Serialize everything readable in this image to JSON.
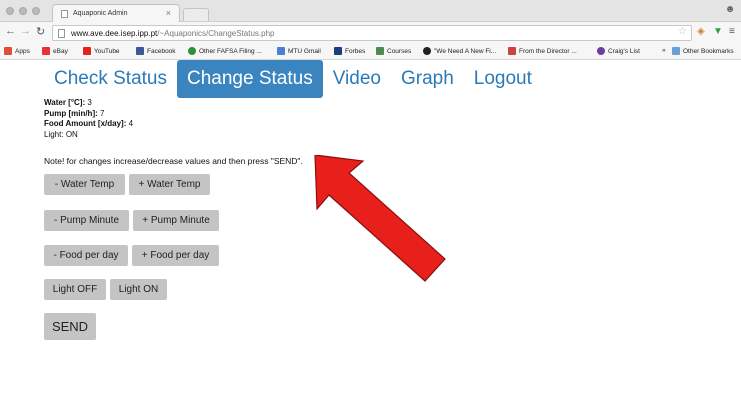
{
  "browser": {
    "tab_title": "Aquaponic Admin",
    "tab_close": "×",
    "url_host": "www.ave.dee.isep.ipp.pt",
    "url_path": "/~Aquaponics/ChangeStatus.php"
  },
  "bookmarks": [
    {
      "label": "Apps",
      "color": "#e04e39"
    },
    {
      "label": "eBay",
      "color": "#e53238"
    },
    {
      "label": "YouTube",
      "color": "#e62117"
    },
    {
      "label": "Facebook",
      "color": "#3b5998"
    },
    {
      "label": "Other FAFSA Filing ...",
      "color": "#2f8f3a"
    },
    {
      "label": "MTU Gmail",
      "color": "#4a7fd4"
    },
    {
      "label": "Forbes",
      "color": "#1a3d7c"
    },
    {
      "label": "Courses",
      "color": "#4c8a4f"
    },
    {
      "label": "\"We Need A New Fi...",
      "color": "#222222"
    },
    {
      "label": "From the Director ...",
      "color": "#c9463d"
    },
    {
      "label": "Craig's List",
      "color": "#6b3fa0"
    },
    {
      "label": "»",
      "color": "#f6f6f6"
    },
    {
      "label": "Other Bookmarks",
      "color": "#6aa0d8"
    }
  ],
  "menu": {
    "check_status": "Check Status",
    "change_status": "Change Status",
    "video": "Video",
    "graph": "Graph",
    "logout": "Logout"
  },
  "status": {
    "water_label": "Water [°C]:",
    "water_value": "3",
    "pump_label": "Pump [min/h]:",
    "pump_value": "7",
    "food_label": "Food Amount [x/day]:",
    "food_value": "4",
    "light_label": "Light:",
    "light_value": "ON"
  },
  "note": "Note! for changes increase/decrease values and then press \"SEND\".",
  "buttons": {
    "water_minus": "- Water Temp",
    "water_plus": "+ Water Temp",
    "pump_minus": "- Pump Minute",
    "pump_plus": "+ Pump Minute",
    "food_minus": "- Food per day",
    "food_plus": "+ Food per day",
    "light_off": "Light OFF",
    "light_on": "Light ON",
    "send": "SEND"
  },
  "colors": {
    "accent": "#3a84c0",
    "link": "#2b7ab8",
    "button": "#c4c4c4",
    "arrow": "#e8201c"
  }
}
